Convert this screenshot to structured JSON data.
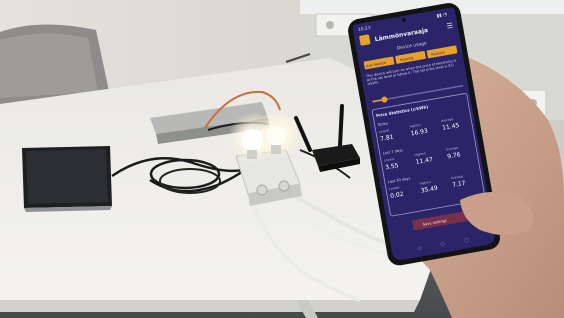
{
  "phone": {
    "app_title": "Lämmönvaraaja",
    "subtitle": "Device usage",
    "mode_buttons": [
      "Just heated",
      "Heating",
      "Remote"
    ],
    "description": "This device will turn on when the price of electricity is at the set level or below it. The set price level is 8.0 c/kWh.",
    "stats_heading": "Price Statistics (c/kWh)",
    "stats": [
      {
        "period": "Today",
        "lowest_label": "Lowest",
        "lowest": "7.81",
        "highest_label": "Highest",
        "highest": "16.93",
        "average_label": "Average",
        "average": "11.45"
      },
      {
        "period": "Last 7 days",
        "lowest_label": "Lowest",
        "lowest": "3.55",
        "highest_label": "Highest",
        "highest": "11.47",
        "average_label": "Average",
        "average": "9.76"
      },
      {
        "period": "Last 30 days",
        "lowest_label": "Lowest",
        "lowest": "0.02",
        "highest_label": "Highest",
        "highest": "35.49",
        "average_label": "Average",
        "average": "7.17"
      }
    ],
    "bottom_button": "Save settings"
  },
  "colors": {
    "app_bg": "#2b2468",
    "accent": "#e8a22a",
    "panel_border": "#9a9acc"
  }
}
